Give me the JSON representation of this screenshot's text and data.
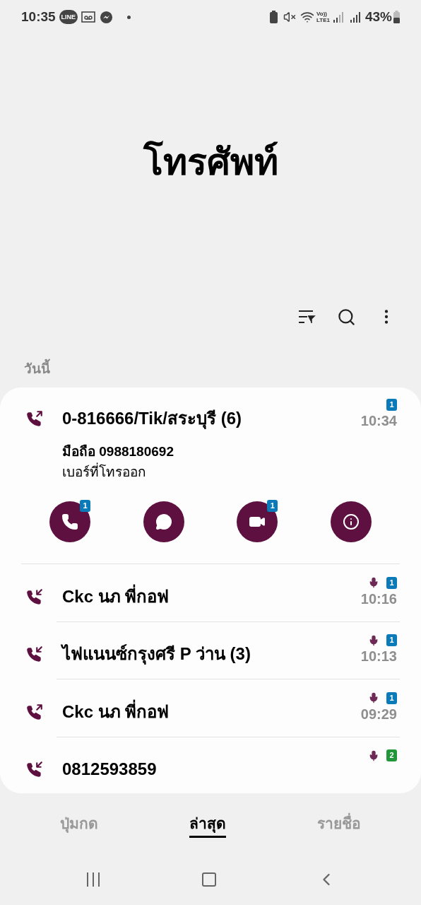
{
  "status_bar": {
    "time": "10:35",
    "line_label": "LINE",
    "volte_label": "Vo))",
    "lte_label": "LTE1",
    "battery": "43%"
  },
  "title": "โทรศัพท์",
  "section": "วันนี้",
  "calls": [
    {
      "name": "0-816666/Tik/สระบุรี (6)",
      "kind": "outgoing",
      "recorded": false,
      "sim": "1",
      "color": "#0a7ab8",
      "time": "10:34",
      "expanded": true,
      "number": "มือถือ 0988180692",
      "note": "เบอร์ที่โทรออก",
      "actions": [
        {
          "kind": "call",
          "sim": "1"
        },
        {
          "kind": "message"
        },
        {
          "kind": "video",
          "sim": "1"
        },
        {
          "kind": "info"
        }
      ]
    },
    {
      "name": "Ckc นภ พี่กอฟ",
      "kind": "incoming",
      "recorded": true,
      "sim": "1",
      "color": "#0a7ab8",
      "time": "10:16",
      "expanded": false
    },
    {
      "name": "ไฟแนนซ์กรุงศรี P ว่าน (3)",
      "kind": "incoming",
      "recorded": true,
      "sim": "1",
      "color": "#0a7ab8",
      "time": "10:13",
      "expanded": false
    },
    {
      "name": "Ckc นภ พี่กอฟ",
      "kind": "outgoing",
      "recorded": true,
      "sim": "1",
      "color": "#0a7ab8",
      "time": "09:29",
      "expanded": false
    },
    {
      "name": "0812593859",
      "kind": "incoming",
      "recorded": true,
      "sim": "2",
      "color": "#22973a",
      "expanded": false
    }
  ],
  "tabs": [
    {
      "label": "ปุ่มกด",
      "selected": false
    },
    {
      "label": "ล่าสุด",
      "selected": true
    },
    {
      "label": "รายชื่อ",
      "selected": false
    }
  ]
}
